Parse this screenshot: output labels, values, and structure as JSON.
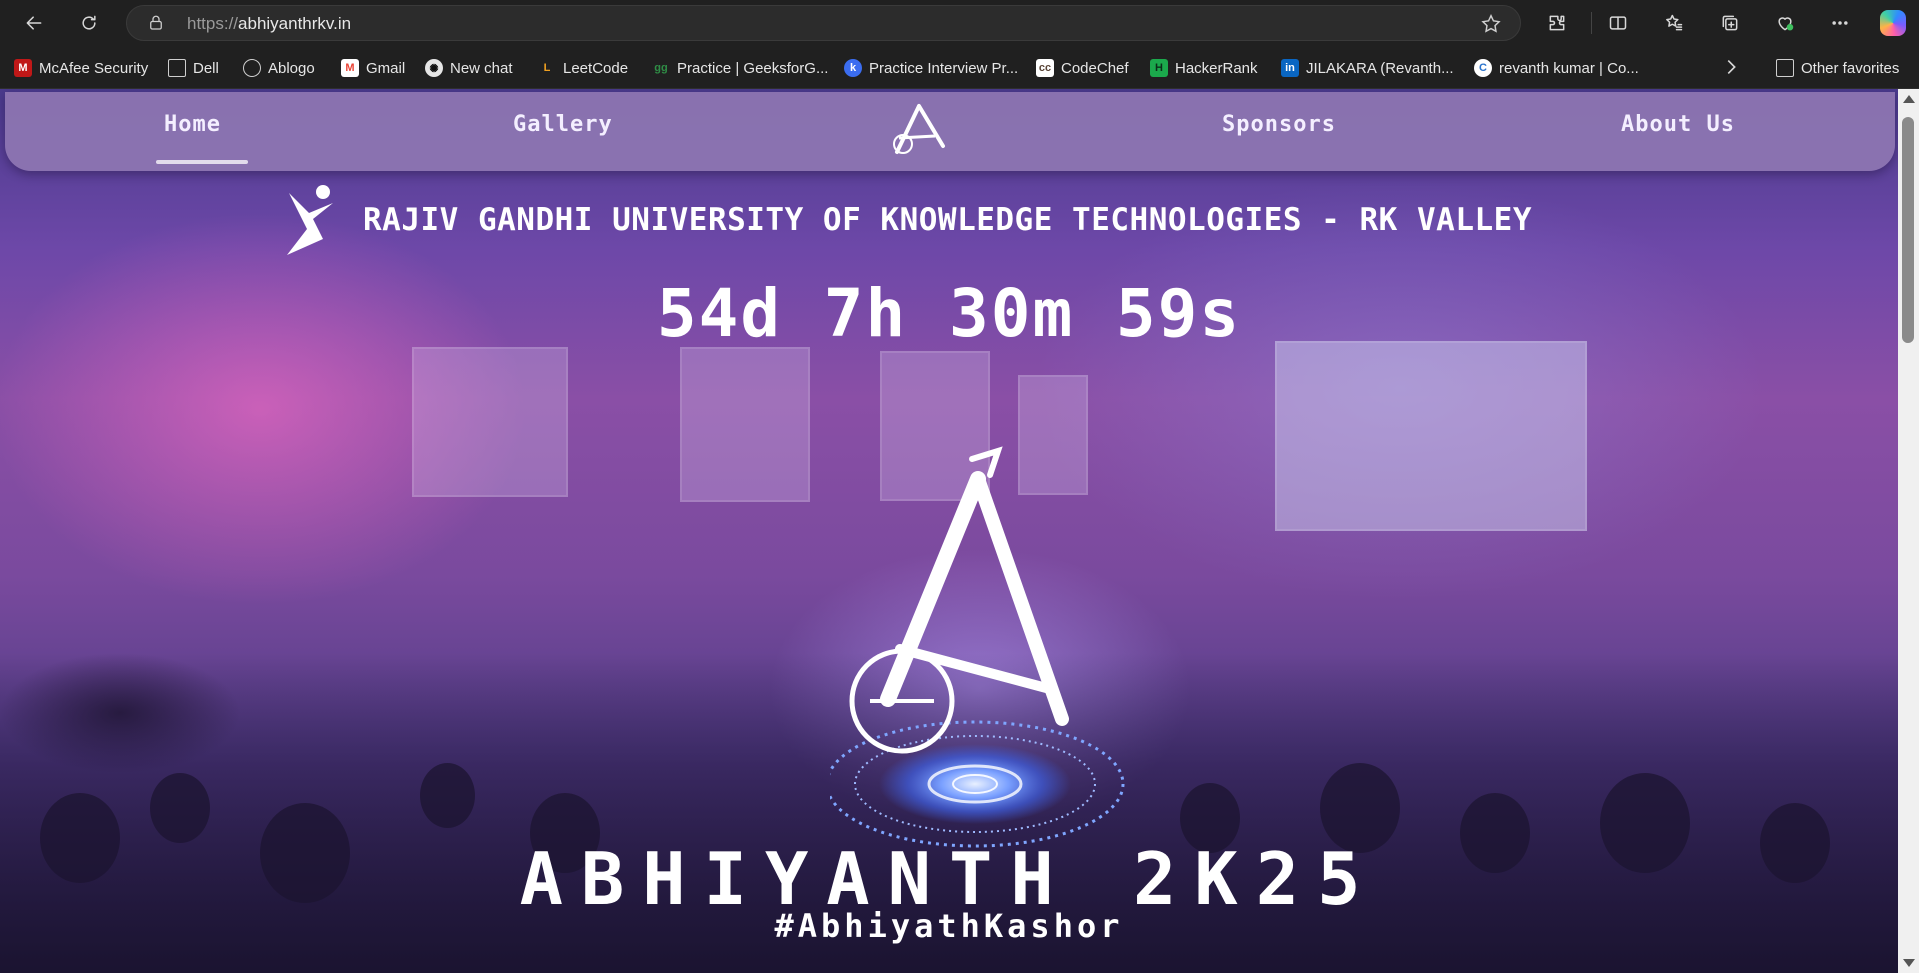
{
  "browser": {
    "url_protocol": "https://",
    "url_host": "abhiyanthrkv.in",
    "bookmarks": [
      {
        "label": "McAfee Security",
        "icon": "mcafee-icon",
        "color": "#c01818"
      },
      {
        "label": "Dell",
        "icon": "folder-icon",
        "color": "#cfcfcf"
      },
      {
        "label": "Ablogo",
        "icon": "globe-icon",
        "color": "#cfcfcf"
      },
      {
        "label": "Gmail",
        "icon": "gmail-icon",
        "color": "#ea4335"
      },
      {
        "label": "New chat",
        "icon": "chatgpt-icon",
        "color": "#e6e6e6"
      },
      {
        "label": "LeetCode",
        "icon": "leetcode-icon",
        "color": "#f0a020"
      },
      {
        "label": "Practice | GeeksforG...",
        "icon": "geeksforgeeks-icon",
        "color": "#2f8d46"
      },
      {
        "label": "Practice Interview Pr...",
        "icon": "interview-icon",
        "color": "#3b6df0"
      },
      {
        "label": "CodeChef",
        "icon": "codechef-icon",
        "color": "#5b4638"
      },
      {
        "label": "HackerRank",
        "icon": "hackerrank-icon",
        "color": "#1ba94c"
      },
      {
        "label": "JILAKARA (Revanth...",
        "icon": "linkedin-icon",
        "color": "#0a66c2"
      },
      {
        "label": "revanth kumar | Co...",
        "icon": "coursera-icon",
        "color": "#2a73cc"
      }
    ],
    "other_favorites": "Other favorites"
  },
  "nav": {
    "home": "Home",
    "gallery": "Gallery",
    "sponsors": "Sponsors",
    "about": "About Us"
  },
  "hero": {
    "university": "RAJIV GANDHI UNIVERSITY OF KNOWLEDGE TECHNOLOGIES - RK VALLEY",
    "countdown": "54d 7h 30m 59s",
    "event_title": "ABHIYANTH 2K25",
    "hashtag": "#AbhiyathKashor"
  },
  "colors": {
    "navbar": "#8e76b2",
    "accent": "#ffffff"
  }
}
